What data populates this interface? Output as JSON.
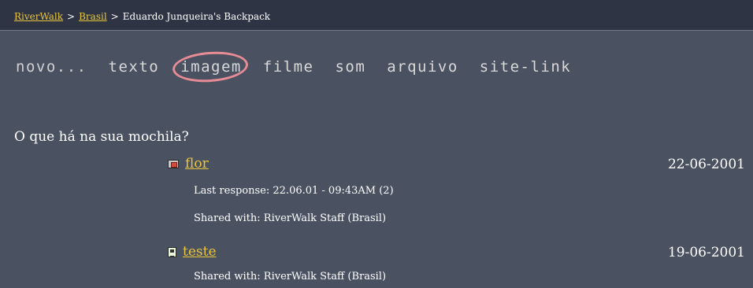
{
  "breadcrumb": {
    "items": [
      "RiverWalk",
      "Brasil"
    ],
    "separator": ">",
    "current": "Eduardo Junqueira's Backpack"
  },
  "new_bar": {
    "lead": "novo...",
    "options": [
      "texto",
      "imagem",
      "filme",
      "som",
      "arquivo",
      "site-link"
    ]
  },
  "question": "O que há na sua mochila?",
  "items": [
    {
      "icon": "image-icon",
      "title": "flor",
      "date": "22-06-2001",
      "last_response": "Last response: 22.06.01 - 09:43AM (2)",
      "shared": "Shared with: RiverWalk Staff (Brasil)"
    },
    {
      "icon": "text-document-icon",
      "title": "teste",
      "date": "19-06-2001",
      "shared": "Shared with: RiverWalk Staff (Brasil)"
    }
  ],
  "colors": {
    "background": "#4a5262",
    "header": "#2e3444",
    "link": "#e9c53a",
    "annotation": "#e78c95"
  }
}
